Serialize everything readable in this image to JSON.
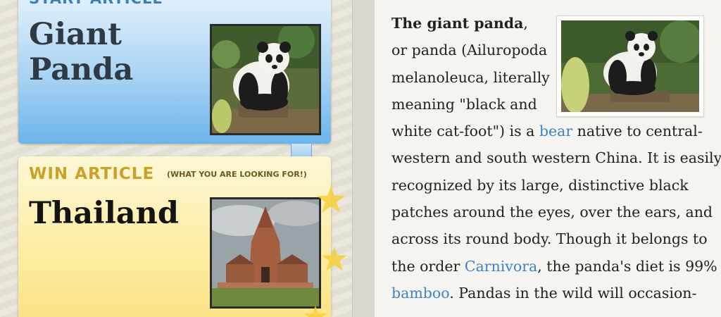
{
  "start": {
    "label": "START ARTICLE",
    "title": "Giant Panda",
    "image_icon": "panda-photo"
  },
  "win": {
    "label": "WIN ARTICLE",
    "sublabel": "(WHAT YOU ARE LOOKING FOR!)",
    "title": "Thailand",
    "image_icon": "temple-photo"
  },
  "article": {
    "image_icon": "panda-photo",
    "lines": [
      {
        "bold": "The giant panda",
        "text": ","
      },
      {
        "text": "or panda (Ailuropoda"
      },
      {
        "text": "melanoleuca, literally"
      },
      {
        "text": "meaning \"black and"
      },
      {
        "text": "white cat-foot\") is a ",
        "link": "bear",
        "after": " native to central-"
      },
      {
        "text": "western and south western China. It is easily"
      },
      {
        "text": "recognized by its large, distinctive black"
      },
      {
        "text": "patches around the eyes, over the ears, and"
      },
      {
        "text": "across its round body. Though it belongs to"
      },
      {
        "text": "the order ",
        "link": "Carnivora",
        "after": ", the panda's diet is 99%"
      },
      {
        "link": "bamboo",
        "after": ". Pandas in the wild will occasion-"
      }
    ]
  },
  "colors": {
    "start_blue": "#6cb4ea",
    "win_yellow": "#fbe283",
    "link": "#3b84c8",
    "start_label": "#3f7fb8",
    "win_label": "#c9a227"
  }
}
